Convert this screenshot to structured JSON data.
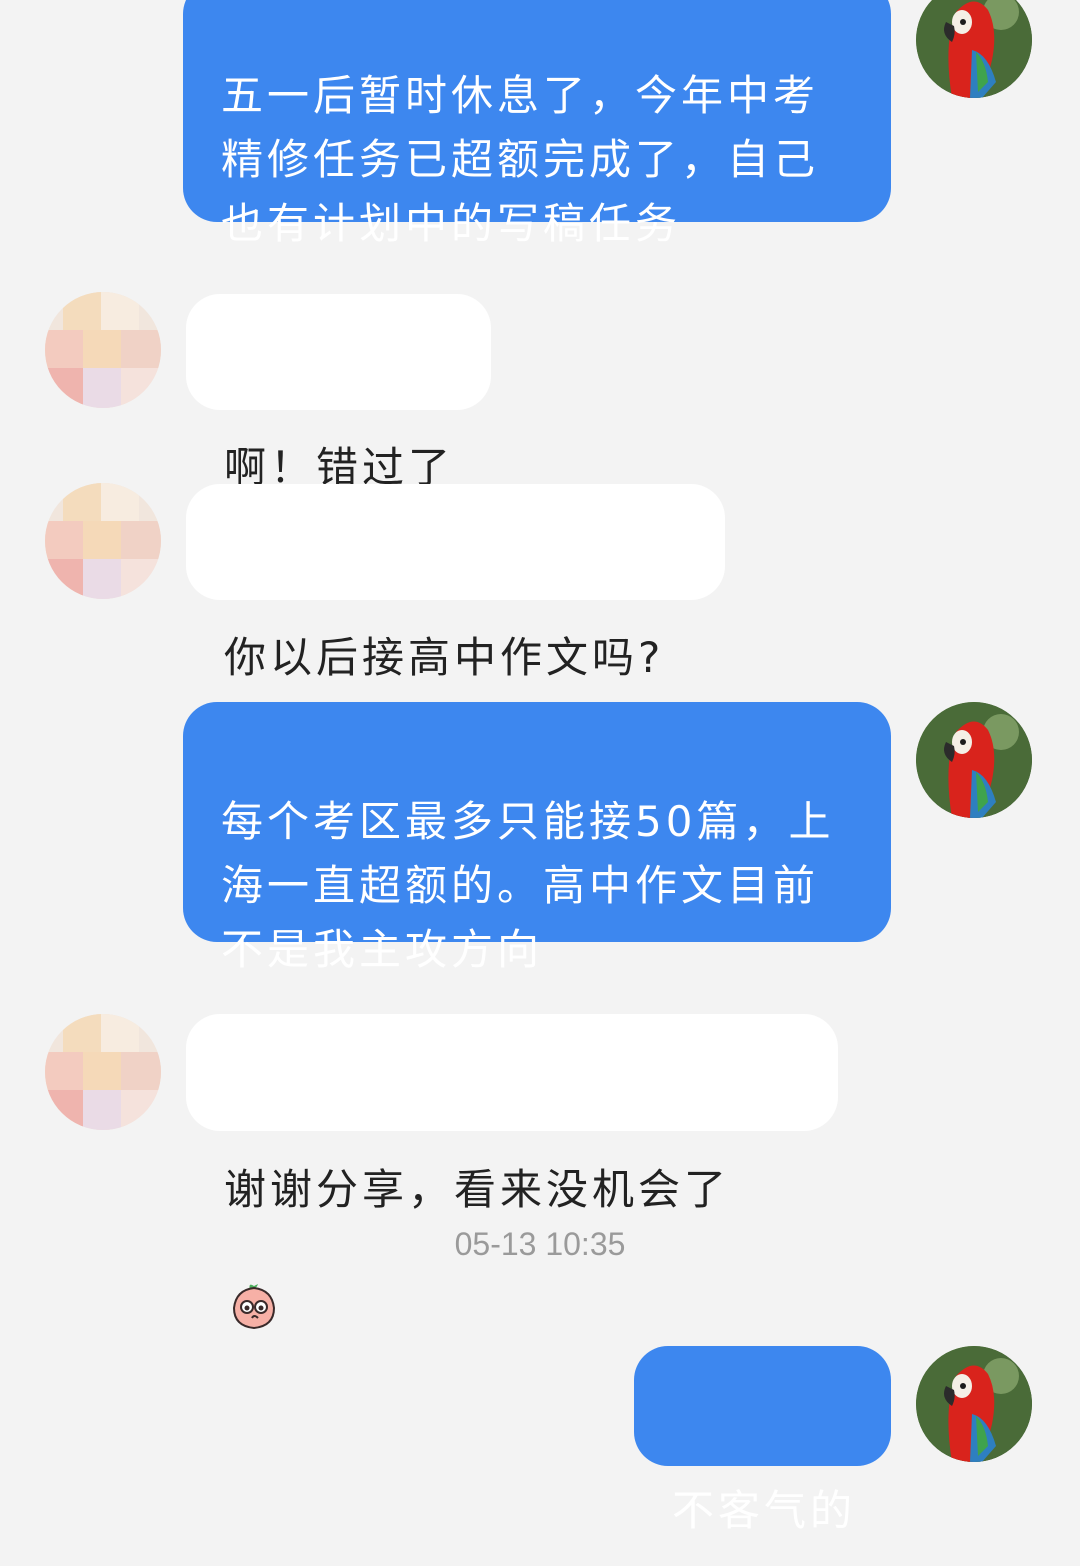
{
  "messages": [
    {
      "side": "out",
      "text": "五一后暂时休息了，今年中考\n精修任务已超额完成了，自己\n也有计划中的写稿任务"
    },
    {
      "side": "in",
      "text": "啊！错过了"
    },
    {
      "side": "in",
      "text": "你以后接高中作文吗?"
    },
    {
      "side": "out",
      "text": "每个考区最多只能接50篇，上\n海一直超额的。高中作文目前\n不是我主攻方向"
    },
    {
      "side": "in",
      "text": "谢谢分享，看来没机会了",
      "emoji": "peach-face-emoji"
    },
    {
      "side": "out",
      "text": "不客气的"
    }
  ],
  "timestamp": "05-13 10:35",
  "colors": {
    "background": "#f3f3f3",
    "outgoing_bubble": "#3d87ef",
    "incoming_bubble": "#ffffff",
    "timestamp_text": "#9a9a9a"
  },
  "icons": {
    "self_avatar": "parrot-avatar",
    "other_avatar": "pixelated-avatar"
  }
}
